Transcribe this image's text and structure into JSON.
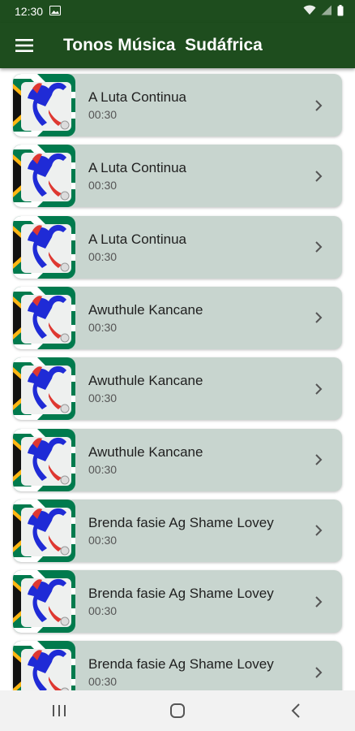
{
  "status": {
    "time": "12:30",
    "icons": [
      "image-icon",
      "wifi-icon",
      "signal-icon",
      "battery-icon"
    ]
  },
  "appbar": {
    "title": "Tonos Música  Sudáfrica",
    "menu_icon": "hamburger-menu-icon"
  },
  "colors": {
    "appbar": "#1e4d1e",
    "card": "#c8d5cf",
    "flag_green": "#007a4d",
    "flag_blue": "#1f2bd6",
    "flag_red": "#de3831",
    "flag_gold": "#ffb612"
  },
  "songs": [
    {
      "title": "A Luta Continua",
      "duration": "00:30"
    },
    {
      "title": "A Luta Continua",
      "duration": "00:30"
    },
    {
      "title": "A Luta Continua",
      "duration": "00:30"
    },
    {
      "title": "Awuthule Kancane",
      "duration": "00:30"
    },
    {
      "title": "Awuthule Kancane",
      "duration": "00:30"
    },
    {
      "title": "Awuthule Kancane",
      "duration": "00:30"
    },
    {
      "title": "Brenda fasie   Ag Shame Lovey",
      "duration": "00:30"
    },
    {
      "title": "Brenda fasie   Ag Shame Lovey",
      "duration": "00:30"
    },
    {
      "title": "Brenda fasie   Ag Shame Lovey",
      "duration": "00:30"
    }
  ],
  "navbar": {
    "icons": [
      "recents-icon",
      "home-icon",
      "back-icon"
    ]
  }
}
